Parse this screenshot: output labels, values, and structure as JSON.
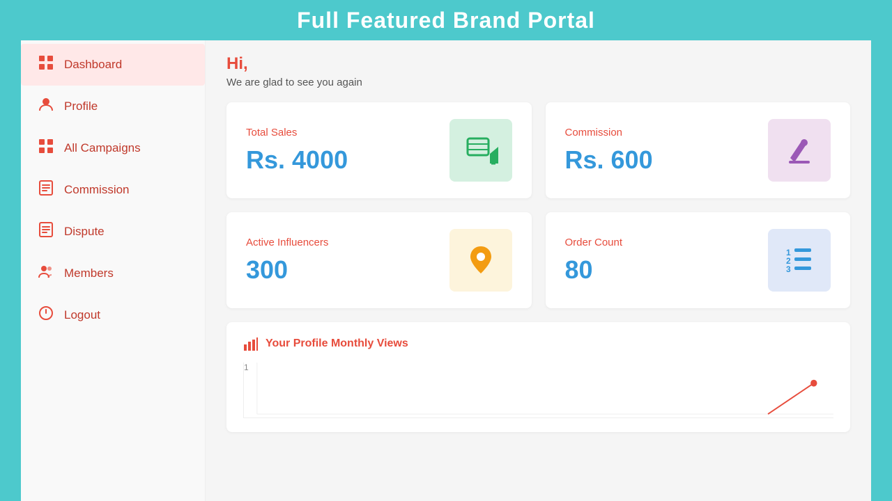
{
  "app": {
    "title": "Full Featured Brand Portal"
  },
  "header": {
    "greeting": "Hi,",
    "subgreeting": "We are glad to see you again"
  },
  "sidebar": {
    "items": [
      {
        "id": "dashboard",
        "label": "Dashboard",
        "icon": "dashboard",
        "active": true
      },
      {
        "id": "profile",
        "label": "Profile",
        "icon": "profile",
        "active": false
      },
      {
        "id": "all-campaigns",
        "label": "All Campaigns",
        "icon": "campaigns",
        "active": false
      },
      {
        "id": "commission",
        "label": "Commission",
        "icon": "commission",
        "active": false
      },
      {
        "id": "dispute",
        "label": "Dispute",
        "icon": "dispute",
        "active": false
      },
      {
        "id": "members",
        "label": "Members",
        "icon": "members",
        "active": false
      },
      {
        "id": "logout",
        "label": "Logout",
        "icon": "logout",
        "active": false
      }
    ]
  },
  "stats": [
    {
      "id": "total-sales",
      "label": "Total Sales",
      "value": "Rs. 4000",
      "icon_color": "green",
      "icon_type": "edit"
    },
    {
      "id": "commission",
      "label": "Commission",
      "value": "Rs. 600",
      "icon_color": "pink",
      "icon_type": "pencil"
    },
    {
      "id": "active-influencers",
      "label": "Active Influencers",
      "value": "300",
      "icon_color": "yellow",
      "icon_type": "location"
    },
    {
      "id": "order-count",
      "label": "Order Count",
      "value": "80",
      "icon_color": "blue",
      "icon_type": "list"
    }
  ],
  "chart": {
    "title": "Your Profile Monthly Views",
    "y_label": "1"
  },
  "colors": {
    "teal": "#4dc9cc",
    "red": "#e74c3c",
    "blue": "#3498db",
    "green_bg": "#d4f0e0",
    "pink_bg": "#f0e0f0",
    "yellow_bg": "#fdf4dc",
    "lavender_bg": "#e0e8f8"
  }
}
